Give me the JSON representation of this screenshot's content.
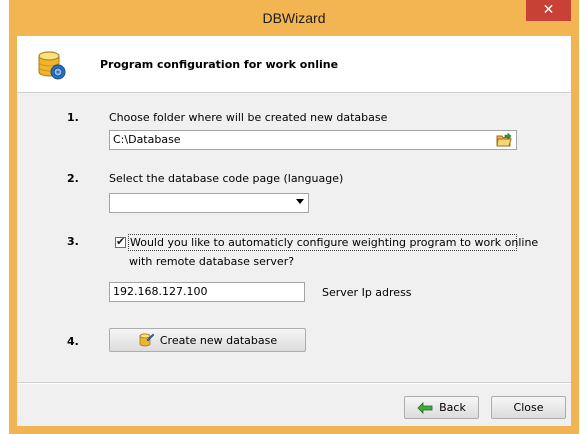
{
  "window": {
    "title": "DBWizard",
    "close_glyph": "✕"
  },
  "header": {
    "title": "Program configuration for work online",
    "icon": "database-gear-icon"
  },
  "steps": {
    "one": {
      "number": "1.",
      "label": "Choose folder where will be created new database",
      "folder_value": "C:\\Database",
      "folder_icon": "open-folder-icon"
    },
    "two": {
      "number": "2.",
      "label": "Select the database code page (language)",
      "codepage_value": ""
    },
    "three": {
      "number": "3.",
      "checked": true,
      "label_line1": "Would you like to automaticly configure weighting program to work online",
      "label_line2": "with remote database server?",
      "ip_value": "192.168.127.100",
      "ip_label": "Server Ip adress"
    },
    "four": {
      "number": "4.",
      "button_label": "Create new database",
      "button_icon": "create-database-icon"
    }
  },
  "footer": {
    "back_label": "Back",
    "back_icon": "back-arrow-icon",
    "close_label": "Close"
  },
  "colors": {
    "titlebar": "#f3b552",
    "close_button": "#c74234",
    "client_bg": "#f0f0f0"
  }
}
